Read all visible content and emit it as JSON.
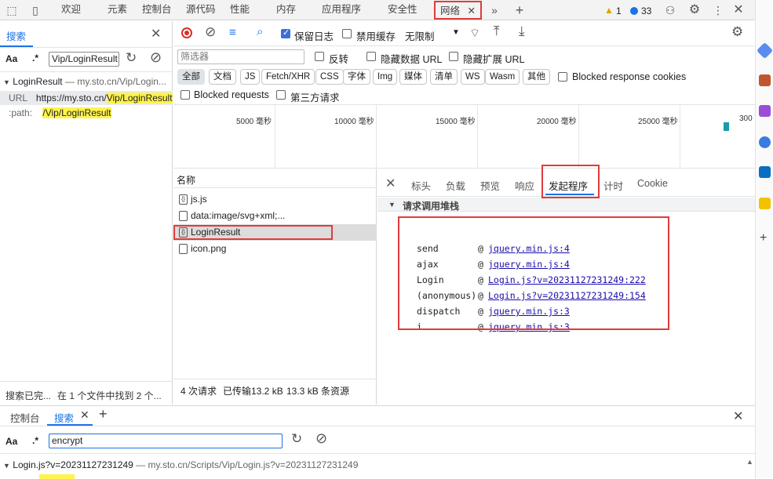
{
  "topbar": {
    "tabs": [
      "欢迎",
      "元素",
      "控制台",
      "源代码",
      "性能",
      "内存",
      "应用程序",
      "安全性",
      "网络"
    ],
    "active_tab": "网络",
    "warning_count": "1",
    "issue_count": "33"
  },
  "search_panel": {
    "tab_label": "搜索",
    "aa": "Aa",
    "regex": ".*",
    "query": "Vip/LoginResult",
    "result_file": "LoginResult",
    "result_url": "— my.sto.cn/Vip/Login...",
    "line1_key": "URL",
    "line1_prefix": "https://my.sto.cn/",
    "line1_match": "Vip/LoginResult",
    "line2_key": ":path:",
    "line2_match": "/Vip/LoginResult",
    "status_left": "搜索已完...",
    "status_right": "在 1 个文件中找到 2 个..."
  },
  "network": {
    "preserve_log": "保留日志",
    "disable_cache": "禁用缓存",
    "throttle": "无限制",
    "filter_placeholder": "筛选器",
    "invert": "反转",
    "hide_data_url": "隐藏数据 URL",
    "hide_ext_url": "隐藏扩展 URL",
    "types": [
      "全部",
      "文档",
      "JS",
      "Fetch/XHR",
      "CSS",
      "字体",
      "Img",
      "媒体",
      "清单",
      "WS",
      "Wasm",
      "其他"
    ],
    "blocked_cookies": "Blocked response cookies",
    "blocked_requests": "Blocked requests",
    "third_party": "第三方请求",
    "timeline_ticks": [
      "5000 毫秒",
      "10000 毫秒",
      "15000 毫秒",
      "20000 毫秒",
      "25000 毫秒",
      "300"
    ],
    "name_header": "名称",
    "requests": [
      {
        "name": "js.js",
        "type": "script"
      },
      {
        "name": "data:image/svg+xml;...",
        "type": "image"
      },
      {
        "name": "LoginResult",
        "type": "xhr"
      },
      {
        "name": "icon.png",
        "type": "image"
      }
    ],
    "summary": {
      "requests": "4 次请求",
      "transferred": "已传输13.2 kB",
      "resources": "13.3 kB 条资源"
    },
    "detail_tabs": [
      "标头",
      "负载",
      "预览",
      "响应",
      "发起程序",
      "计时",
      "Cookie"
    ],
    "active_detail_tab": "发起程序",
    "stack_title": "请求调用堆栈",
    "stack": [
      {
        "fn": "send",
        "at": "@",
        "loc": "jquery.min.js:4"
      },
      {
        "fn": "ajax",
        "at": "@",
        "loc": "jquery.min.js:4"
      },
      {
        "fn": "Login",
        "at": "@",
        "loc": "Login.js?v=20231127231249:222"
      },
      {
        "fn": "(anonymous)",
        "at": "@",
        "loc": "Login.js?v=20231127231249:154"
      },
      {
        "fn": "dispatch",
        "at": "@",
        "loc": "jquery.min.js:3"
      },
      {
        "fn": "i",
        "at": "@",
        "loc": "jquery.min.js:3"
      }
    ]
  },
  "drawer": {
    "tabs": [
      "控制台",
      "搜索"
    ],
    "active_tab": "搜索",
    "aa": "Aa",
    "regex": ".*",
    "query": "encrypt",
    "result_file": "Login.js?v=20231127231249",
    "result_url": "— my.sto.cn/Scripts/Vip/Login.js?v=20231127231249"
  },
  "colors": {
    "accent": "#1a73e8",
    "highlight_box": "#e03b3b",
    "match_highlight": "#fff34d"
  }
}
